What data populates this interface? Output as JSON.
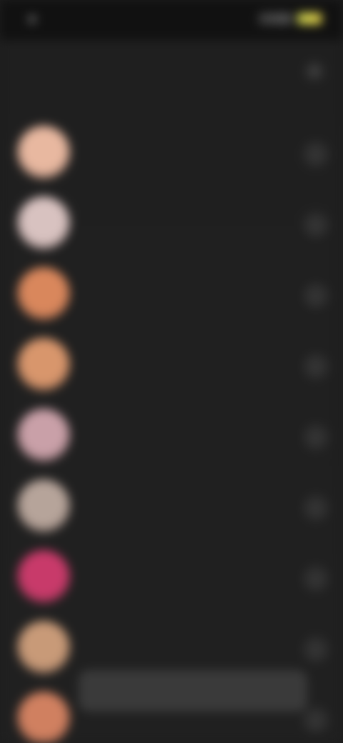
{
  "status_bar": {
    "time": "",
    "battery_color": "#e0d24c"
  },
  "header": {
    "title": "",
    "close_icon": "close-icon"
  },
  "contacts": [
    {
      "name": "",
      "subtitle": "",
      "avatar_color": "#e8b8a0",
      "action_icon": "chevron-right-icon"
    },
    {
      "name": "",
      "subtitle": "",
      "avatar_color": "#d8c2c0",
      "action_icon": "chevron-right-icon"
    },
    {
      "name": "",
      "subtitle": "",
      "avatar_color": "#d9875c",
      "action_icon": "chevron-right-icon"
    },
    {
      "name": "",
      "subtitle": "",
      "avatar_color": "#d8966c",
      "action_icon": "chevron-right-icon"
    },
    {
      "name": "",
      "subtitle": "",
      "avatar_color": "#c9a0a8",
      "action_icon": "chevron-right-icon"
    },
    {
      "name": "",
      "subtitle": "",
      "avatar_color": "#b6a49a",
      "action_icon": "chevron-right-icon"
    },
    {
      "name": "",
      "subtitle": "",
      "avatar_color": "#c83a6a",
      "action_icon": "chevron-right-icon"
    },
    {
      "name": "",
      "subtitle": "",
      "avatar_color": "#c89a78",
      "action_icon": "chevron-right-icon"
    },
    {
      "name": "",
      "subtitle": "",
      "avatar_color": "#d08060",
      "action_icon": "chevron-right-icon"
    }
  ],
  "toast": {
    "text": ""
  }
}
